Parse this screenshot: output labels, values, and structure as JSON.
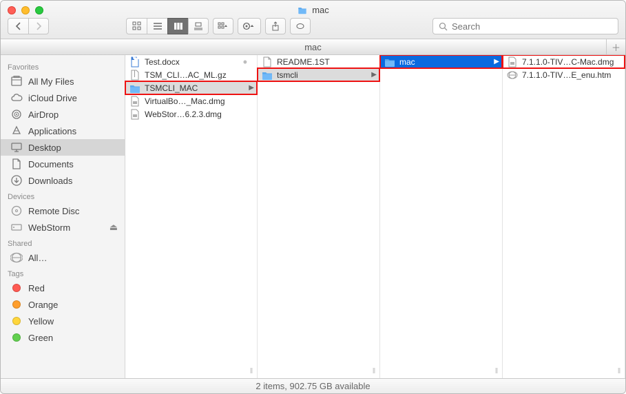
{
  "window_title": "mac",
  "search_placeholder": "Search",
  "tab_label": "mac",
  "sidebar": {
    "sections": [
      {
        "title": "Favorites",
        "items": [
          {
            "label": "All My Files",
            "icon": "all-my-files"
          },
          {
            "label": "iCloud Drive",
            "icon": "icloud"
          },
          {
            "label": "AirDrop",
            "icon": "airdrop"
          },
          {
            "label": "Applications",
            "icon": "applications"
          },
          {
            "label": "Desktop",
            "icon": "desktop",
            "active": true
          },
          {
            "label": "Documents",
            "icon": "documents"
          },
          {
            "label": "Downloads",
            "icon": "downloads"
          }
        ]
      },
      {
        "title": "Devices",
        "items": [
          {
            "label": "Remote Disc",
            "icon": "disc"
          },
          {
            "label": "WebStorm",
            "icon": "drive",
            "eject": true
          }
        ]
      },
      {
        "title": "Shared",
        "items": [
          {
            "label": "All…",
            "icon": "globe"
          }
        ]
      },
      {
        "title": "Tags",
        "items": [
          {
            "label": "Red",
            "tag": "#ff5a52"
          },
          {
            "label": "Orange",
            "tag": "#ff9e2c"
          },
          {
            "label": "Yellow",
            "tag": "#ffd63b"
          },
          {
            "label": "Green",
            "tag": "#62d04f"
          }
        ]
      }
    ]
  },
  "columns": [
    [
      {
        "label": "Test.docx",
        "icon": "docx",
        "dim": true
      },
      {
        "label": "TSM_CLI…AC_ML.gz",
        "icon": "archive"
      },
      {
        "label": "TSMCLI_MAC",
        "icon": "folder",
        "sel": "gray",
        "arrow": true,
        "hl": true
      },
      {
        "label": "VirtualBo…_Mac.dmg",
        "icon": "dmg"
      },
      {
        "label": "WebStor…6.2.3.dmg",
        "icon": "dmg"
      }
    ],
    [
      {
        "label": "README.1ST",
        "icon": "file"
      },
      {
        "label": "tsmcli",
        "icon": "folder",
        "sel": "gray",
        "arrow": true,
        "hl": true
      }
    ],
    [
      {
        "label": "mac",
        "icon": "folder",
        "sel": "blue",
        "arrow": true,
        "hl": true
      }
    ],
    [
      {
        "label": "7.1.1.0-TIV…C-Mac.dmg",
        "icon": "dmg",
        "hl": true
      },
      {
        "label": "7.1.1.0-TIV…E_enu.htm",
        "icon": "htm"
      }
    ]
  ],
  "status": "2 items, 902.75 GB available"
}
